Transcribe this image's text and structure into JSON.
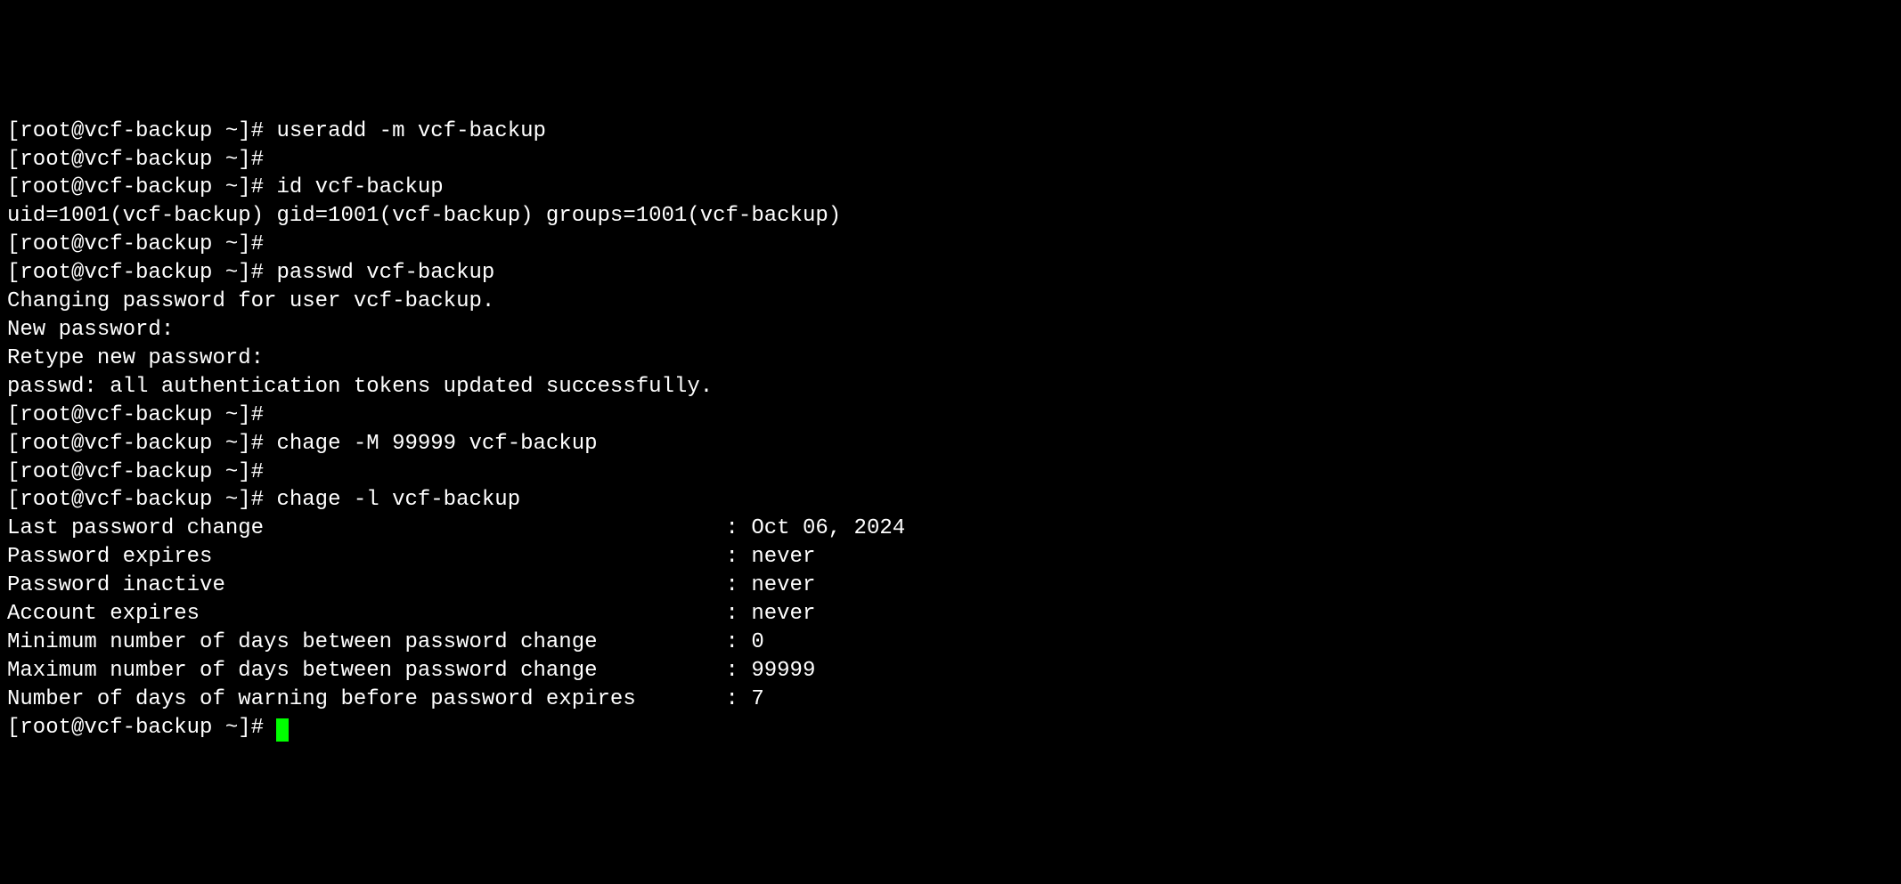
{
  "prompt": "[root@vcf-backup ~]# ",
  "lines": {
    "l1_cmd": "useradd -m vcf-backup",
    "l2_cmd": "",
    "l3_cmd": "id vcf-backup",
    "l4_out": "uid=1001(vcf-backup) gid=1001(vcf-backup) groups=1001(vcf-backup)",
    "l5_cmd": "",
    "l6_cmd": "passwd vcf-backup",
    "l7_out": "Changing password for user vcf-backup.",
    "l8_out": "New password:",
    "l9_out": "Retype new password:",
    "l10_out": "passwd: all authentication tokens updated successfully.",
    "l11_cmd": "",
    "l12_cmd": "chage -M 99999 vcf-backup",
    "l13_cmd": "",
    "l14_cmd": "chage -l vcf-backup",
    "chage": [
      {
        "label": "Last password change",
        "value": "Oct 06, 2024"
      },
      {
        "label": "Password expires",
        "value": "never"
      },
      {
        "label": "Password inactive",
        "value": "never"
      },
      {
        "label": "Account expires",
        "value": "never"
      },
      {
        "label": "Minimum number of days between password change",
        "value": "0"
      },
      {
        "label": "Maximum number of days between password change",
        "value": "99999"
      },
      {
        "label": "Number of days of warning before password expires",
        "value": "7"
      }
    ],
    "last_cmd": ""
  }
}
